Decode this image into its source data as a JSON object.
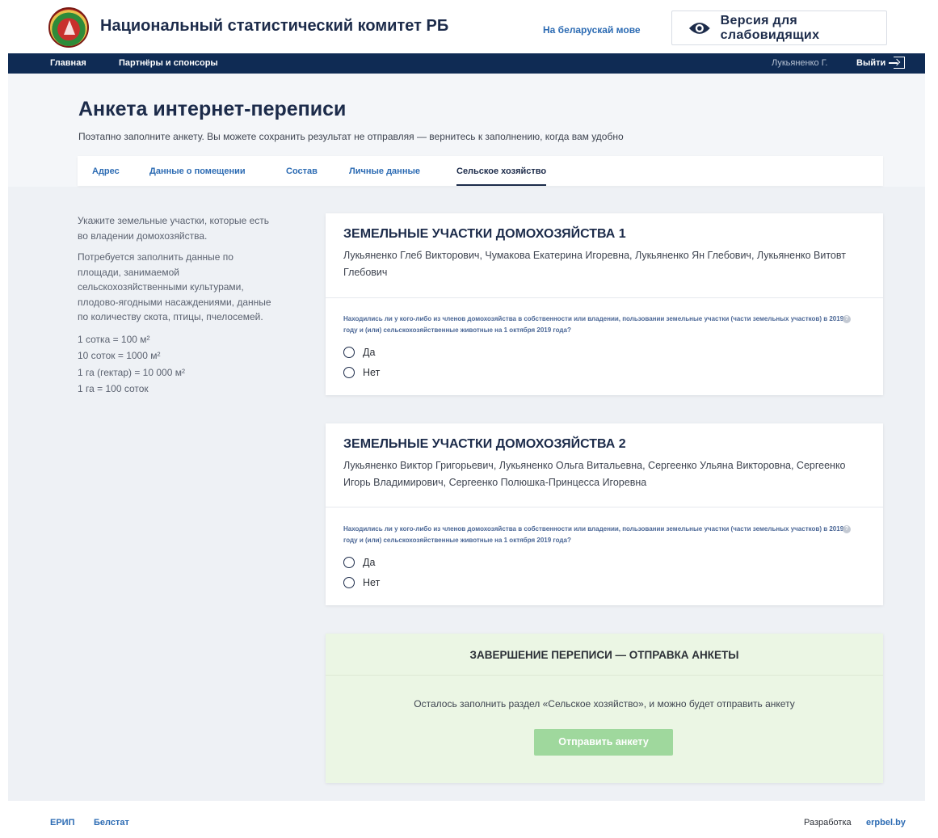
{
  "header": {
    "site_title": "Национальный статистический комитет РБ",
    "lang_link": "На беларускай мове",
    "vision_button": "Версия для слабовидящих"
  },
  "nav": {
    "home": "Главная",
    "partners": "Партнёры и спонсоры",
    "user": "Лукьяненко Г.",
    "logout": "Выйти"
  },
  "page": {
    "title": "Анкета интернет-переписи",
    "subtitle": "Поэтапно заполните анкету. Вы можете сохранить результат не отправляя — вернитесь к заполнению, когда вам удобно"
  },
  "tabs": [
    "Адрес",
    "Данные о помещении",
    "Состав",
    "Личные данные",
    "Сельское хозяйство"
  ],
  "active_tab": "Сельское хозяйство",
  "sidebar": {
    "intro": "Укажите земельные участки, которые есть во владении домохозяйства.",
    "details": "Потребуется заполнить данные по площади, занимаемой сельскохозяйственными культурами, плодово-ягодными насаждениями, данные по количеству скота, птицы, пчелосемей.",
    "units": [
      "1 сотка = 100 м²",
      "10 соток = 1000 м²",
      "1 га (гектар) = 10 000 м²",
      "1 га = 100 соток"
    ]
  },
  "households": [
    {
      "title": "ЗЕМЕЛЬНЫЕ УЧАСТКИ ДОМОХОЗЯЙСТВА 1",
      "members": "Лукьяненко Глеб Викторович, Чумакова Екатерина Игоревна, Лукьяненко Ян Глебович, Лукьяненко Витовт Глебович",
      "question": "Находились ли у кого-либо из членов домохозяйства в собственности или владении, пользовании земельные участки (части земельных участков) в 2019 году и (или) сельскохозяйственные животные на 1 октября 2019 года?",
      "options": [
        "Да",
        "Нет"
      ]
    },
    {
      "title": "ЗЕМЕЛЬНЫЕ УЧАСТКИ ДОМОХОЗЯЙСТВА 2",
      "members": "Лукьяненко Виктор Григорьевич, Лукьяненко Ольга Витальевна, Сергеенко Ульяна Викторовна, Сергеенко Игорь Владимирович, Сергеенко Полюшка-Принцесса Игоревна",
      "question": "Находились ли у кого-либо из членов домохозяйства в собственности или владении, пользовании земельные участки (части земельных участков) в 2019 году и (или) сельскохозяйственные животные на 1 октября 2019 года?",
      "options": [
        "Да",
        "Нет"
      ]
    }
  ],
  "finish": {
    "title": "ЗАВЕРШЕНИЕ ПЕРЕПИСИ — ОТПРАВКА АНКЕТЫ",
    "text": "Осталось заполнить раздел «Сельское хозяйство», и можно будет отправить анкету",
    "button": "Отправить анкету"
  },
  "footer": {
    "erip": "ЕРИП",
    "belstat": "Белстат",
    "dev_label": "Разработка",
    "dev_link": "erpbel.by"
  },
  "colors": {
    "navy": "#0f2b54",
    "link_blue": "#2c6bb3",
    "title_navy": "#1c2b4a",
    "finish_bg": "#ebf6e4",
    "send_button": "#9fd89d",
    "page_bg": "#eef1f5"
  },
  "icons": [
    "logo-emblem",
    "eye-icon",
    "logout-icon",
    "help-icon",
    "radio-icon"
  ]
}
